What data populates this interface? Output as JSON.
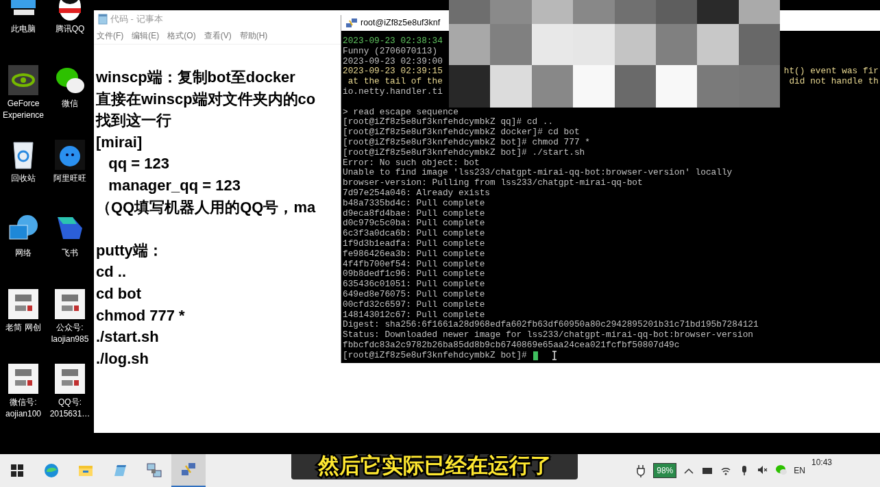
{
  "desktop_icons": [
    {
      "kind": "computer",
      "label": "此电脑"
    },
    {
      "kind": "penguin",
      "label": "腾讯QQ"
    },
    {
      "kind": "gpu",
      "label": "GeForce\nExperience"
    },
    {
      "kind": "chat",
      "label": "微信"
    },
    {
      "kind": "bin",
      "label": "回收站"
    },
    {
      "kind": "drop",
      "label": "阿里旺旺"
    },
    {
      "kind": "globe",
      "label": "网络"
    },
    {
      "kind": "bird",
      "label": "飞书"
    },
    {
      "kind": "logo",
      "label": "老简 网创"
    },
    {
      "kind": "logo",
      "label": "公众号:\nlaojian985"
    },
    {
      "kind": "logo",
      "label": "微信号:\naojian100"
    },
    {
      "kind": "logo",
      "label": "QQ号:\n2015631…"
    }
  ],
  "notepad": {
    "title": "代码 - 记事本",
    "menu": [
      "文件(F)",
      "编辑(E)",
      "格式(O)",
      "查看(V)",
      "帮助(H)"
    ],
    "lines": [
      {
        "kind": "text",
        "text": "winscp端：复制bot至docker"
      },
      {
        "kind": "text",
        "text": "直接在winscp端对文件夹内的co"
      },
      {
        "kind": "text",
        "text": "找到这一行"
      },
      {
        "kind": "text",
        "text": "[mirai]"
      },
      {
        "kind": "text",
        "text": "   qq = 123"
      },
      {
        "kind": "text",
        "text": "   manager_qq = 123"
      },
      {
        "kind": "text",
        "text": "（QQ填写机器人用的QQ号，ma"
      },
      {
        "kind": "blank"
      },
      {
        "kind": "text",
        "text": "putty端："
      },
      {
        "kind": "text",
        "text": "cd .."
      },
      {
        "kind": "text",
        "text": "cd bot"
      },
      {
        "kind": "text",
        "text": "chmod 777 *"
      },
      {
        "kind": "text",
        "text": "./start.sh"
      },
      {
        "kind": "text",
        "text": "./log.sh"
      }
    ]
  },
  "putty": {
    "title": "root@iZf8z5e8uf3knf",
    "lines": [
      {
        "kind": "text",
        "text": "2023-09-23 02:38:34",
        "color": "#5fc35f"
      },
      {
        "kind": "text",
        "text": "Funny (2706070113)",
        "color": "#c0c0c0"
      },
      {
        "kind": "text",
        "text": "2023-09-23 02:39:00",
        "color": "#c0c0c0"
      },
      {
        "kind": "text",
        "text": "2023-09-23 02:39:15",
        "right": "ht() event was fir",
        "color": "#e6d690"
      },
      {
        "kind": "text",
        "text": " at the tail of the",
        "right": "did not handle th",
        "color": "#e6d690"
      },
      {
        "kind": "text",
        "text": "io.netty.handler.ti",
        "color": "#c0c0c0"
      },
      {
        "kind": "blank"
      },
      {
        "kind": "text",
        "text": "> read escape sequence",
        "color": "#c0c0c0"
      },
      {
        "kind": "text",
        "text": "[root@iZf8z5e8uf3knfehdcymbkZ qq]# cd ..",
        "color": "#c0c0c0"
      },
      {
        "kind": "text",
        "text": "[root@iZf8z5e8uf3knfehdcymbkZ docker]# cd bot",
        "color": "#c0c0c0"
      },
      {
        "kind": "text",
        "text": "[root@iZf8z5e8uf3knfehdcymbkZ bot]# chmod 777 *",
        "color": "#c0c0c0"
      },
      {
        "kind": "text",
        "text": "[root@iZf8z5e8uf3knfehdcymbkZ bot]# ./start.sh",
        "color": "#c0c0c0"
      },
      {
        "kind": "text",
        "text": "Error: No such object: bot",
        "color": "#c0c0c0"
      },
      {
        "kind": "text",
        "text": "Unable to find image 'lss233/chatgpt-mirai-qq-bot:browser-version' locally",
        "color": "#c0c0c0"
      },
      {
        "kind": "text",
        "text": "browser-version: Pulling from lss233/chatgpt-mirai-qq-bot",
        "color": "#c0c0c0"
      },
      {
        "kind": "text",
        "text": "7d97e254a046: Already exists",
        "color": "#c0c0c0"
      },
      {
        "kind": "text",
        "text": "b48a7335bd4c: Pull complete",
        "color": "#c0c0c0"
      },
      {
        "kind": "text",
        "text": "d9eca8fd4bae: Pull complete",
        "color": "#c0c0c0"
      },
      {
        "kind": "text",
        "text": "d0c979c5c0ba: Pull complete",
        "color": "#c0c0c0"
      },
      {
        "kind": "text",
        "text": "6c3f3a0dca6b: Pull complete",
        "color": "#c0c0c0"
      },
      {
        "kind": "text",
        "text": "1f9d3b1eadfa: Pull complete",
        "color": "#c0c0c0"
      },
      {
        "kind": "text",
        "text": "fe986426ea3b: Pull complete",
        "color": "#c0c0c0"
      },
      {
        "kind": "text",
        "text": "4f4fb700ef54: Pull complete",
        "color": "#c0c0c0"
      },
      {
        "kind": "text",
        "text": "09b8dedf1c96: Pull complete",
        "color": "#c0c0c0"
      },
      {
        "kind": "text",
        "text": "635436c01051: Pull complete",
        "color": "#c0c0c0"
      },
      {
        "kind": "text",
        "text": "649ed8e76075: Pull complete",
        "color": "#c0c0c0"
      },
      {
        "kind": "text",
        "text": "00cfd32c6597: Pull complete",
        "color": "#c0c0c0"
      },
      {
        "kind": "text",
        "text": "148143012c67: Pull complete",
        "color": "#c0c0c0"
      },
      {
        "kind": "text",
        "text": "Digest: sha256:6f1661a28d968edfa602fb63df60950a80c2942895201b31c71bd195b7284121",
        "color": "#c0c0c0"
      },
      {
        "kind": "text",
        "text": "Status: Downloaded newer image for lss233/chatgpt-mirai-qq-bot:browser-version",
        "color": "#c0c0c0"
      },
      {
        "kind": "text",
        "text": "fbbcfdc83a2c9782b26ba85dd8b9cb6740869e65aa24cea021fcfbf50807d49c",
        "color": "#c0c0c0"
      },
      {
        "kind": "prompt",
        "text": "[root@iZf8z5e8uf3knfehdcymbkZ bot]#",
        "color": "#c0c0c0"
      }
    ]
  },
  "taskbar": {
    "apps": [
      {
        "kind": "start",
        "selected": false
      },
      {
        "kind": "browser",
        "selected": false
      },
      {
        "kind": "folder",
        "selected": false
      },
      {
        "kind": "notepad",
        "selected": false
      },
      {
        "kind": "transfer",
        "selected": false
      },
      {
        "kind": "terminal",
        "selected": true
      }
    ],
    "battery": "98%",
    "language": "EN",
    "time": "10:43"
  },
  "subtitle": "然后它实际已经在运行了"
}
